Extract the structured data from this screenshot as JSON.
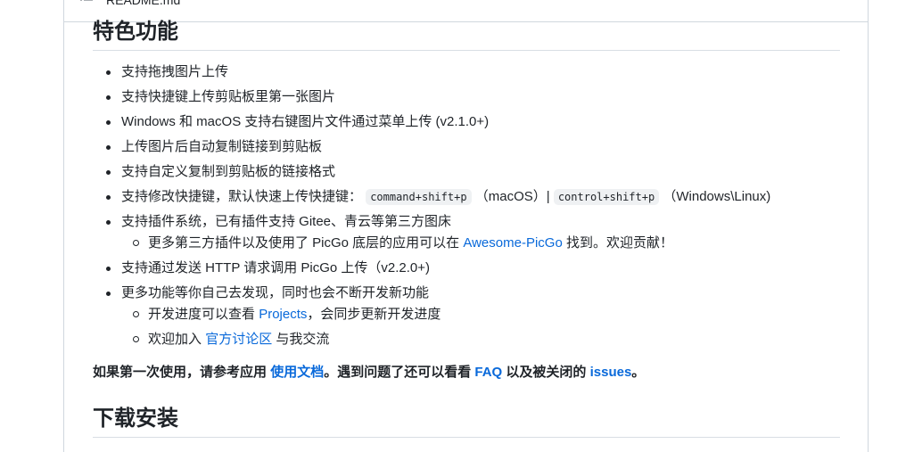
{
  "file_header": {
    "filename": "README.md",
    "icon": "list-icon"
  },
  "section1": {
    "heading": "特色功能",
    "items": [
      {
        "text": "支持拖拽图片上传"
      },
      {
        "text": "支持快捷键上传剪贴板里第一张图片"
      },
      {
        "text": "Windows 和 macOS 支持右键图片文件通过菜单上传 (v2.1.0+)"
      },
      {
        "text": "上传图片后自动复制链接到剪贴板"
      },
      {
        "text": "支持自定义复制到剪贴板的链接格式"
      },
      {
        "prefix": "支持修改快捷键，默认快速上传快捷键：",
        "code1": "command+shift+p",
        "mid": "（macOS）|",
        "code2": "control+shift+p",
        "suffix": "（Windows\\Linux)"
      },
      {
        "text": "支持插件系统，已有插件支持 Gitee、青云等第三方图床",
        "sub": {
          "prefix": "更多第三方插件以及使用了 PicGo 底层的应用可以在",
          "link": "Awesome-PicGo",
          "suffix": "找到。欢迎贡献！"
        }
      },
      {
        "text": "支持通过发送 HTTP 请求调用 PicGo 上传（v2.2.0+)"
      },
      {
        "text": "更多功能等你自己去发现，同时也会不断开发新功能",
        "sub1": {
          "prefix": "开发进度可以查看",
          "link": "Projects",
          "suffix": "，会同步更新开发进度"
        },
        "sub2": {
          "prefix": "欢迎加入",
          "link": "官方讨论区",
          "suffix": "与我交流"
        }
      }
    ]
  },
  "note": {
    "p1": "如果第一次使用，请参考应用",
    "link1": "使用文档",
    "p2": "。遇到问题了还可以看看",
    "link2": "FAQ",
    "p3": "以及被关闭的",
    "link3": "issues",
    "p4": "。"
  },
  "section2": {
    "heading": "下载安装"
  },
  "colors": {
    "link": "#0969da",
    "text": "#1f2328",
    "border": "#d0d7de"
  }
}
